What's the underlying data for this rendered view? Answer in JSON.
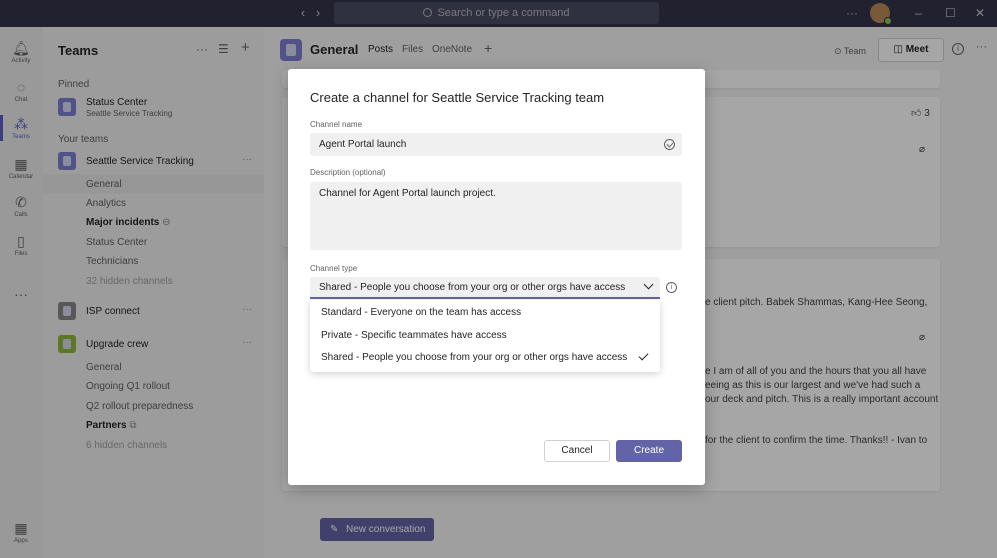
{
  "titlebar": {
    "back_icon": "chevron-left-icon",
    "forward_icon": "chevron-right-icon",
    "search_placeholder": "Search or type a command",
    "more": "···",
    "minimize": "–",
    "maximize": "☐",
    "close": "✕"
  },
  "appbar": {
    "items": [
      {
        "label": "Activity",
        "icon": "bell-icon"
      },
      {
        "label": "Chat",
        "icon": "chat-icon"
      },
      {
        "label": "Teams",
        "icon": "teams-icon"
      },
      {
        "label": "Calendar",
        "icon": "calendar-icon"
      },
      {
        "label": "Calls",
        "icon": "phone-icon"
      },
      {
        "label": "Files",
        "icon": "file-icon"
      },
      {
        "label": "Apps",
        "icon": "apps-icon"
      }
    ],
    "more": "···"
  },
  "panel": {
    "title": "Teams",
    "more": "···",
    "filter_icon": "filter-icon",
    "add": "+",
    "pinned_label": "Pinned",
    "pinned": {
      "name": "Status Center",
      "sub": "Seattle Service Tracking"
    },
    "your_teams_label": "Your teams",
    "team1": {
      "name": "Seattle Service Tracking",
      "more": "···",
      "channels": [
        "General",
        "Analytics",
        "Major incidents",
        "Status Center",
        "Technicians"
      ],
      "hidden": "32 hidden channels"
    },
    "team2": {
      "name": "ISP connect",
      "more": "···"
    },
    "team3": {
      "name": "Upgrade crew",
      "more": "···",
      "channels": [
        "General",
        "Ongoing Q1 rollout",
        "Q2 rollout preparedness",
        "Partners"
      ],
      "hidden": "6 hidden channels"
    }
  },
  "channel_header": {
    "title": "General",
    "tabs": [
      "Posts",
      "Files",
      "OneNote"
    ],
    "add_tab": "+",
    "team_label": "Team",
    "meet": "Meet",
    "info": "i"
  },
  "background": {
    "reaction_count": "3",
    "pitch_line": "e client pitch. Babek Shammas, Kang-Hee Seong,",
    "msg_line1": "e I am of all of you and the hours that you all have",
    "msg_line2": "eeing as this is our largest and we've had such a",
    "msg_line3": "our deck and pitch. This is a really important account",
    "msg_line4": "for the client to confirm the time. Thanks!! - Ivan to",
    "new_conversation": "New conversation"
  },
  "dialog": {
    "title": "Create a channel for Seattle Service Tracking team",
    "name_label": "Channel name",
    "name_value": "Agent Portal launch",
    "desc_label": "Description (optional)",
    "desc_value": "Channel for Agent Portal launch project.",
    "type_label": "Channel type",
    "type_value": "Shared - People you choose from your org or other orgs have access",
    "options": [
      {
        "label": "Standard - Everyone on the team has access",
        "selected": false
      },
      {
        "label": "Private - Specific teammates have access",
        "selected": false
      },
      {
        "label": "Shared - People you choose from your org or other orgs have access",
        "selected": true
      }
    ],
    "cancel": "Cancel",
    "create": "Create"
  },
  "colors": {
    "brand": "#6264a7",
    "titlebar": "#33344a"
  }
}
